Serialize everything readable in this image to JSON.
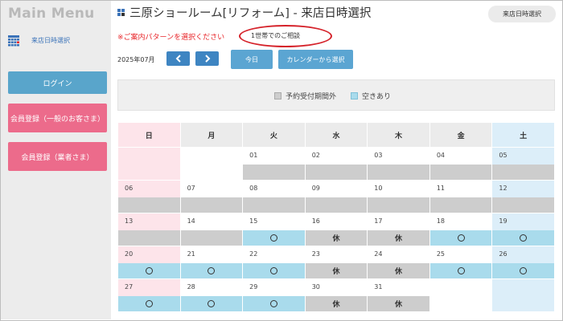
{
  "sidebar": {
    "title": "Main Menu",
    "link_label": "来店日時選択",
    "login_label": "ログイン",
    "register_general_label": "会員登録（一般のお客さま）",
    "register_business_label": "会員登録（業者さま）"
  },
  "header": {
    "title": "三原ショールーム[リフォーム] - 来店日時選択",
    "right_label": "来店日時選択"
  },
  "notice": "※ご案内パターンを選択ください",
  "pattern_label": "1世帯でのご相談",
  "month_label": "2025年07月",
  "buttons": {
    "today": "今日",
    "calendar_select": "カレンダーから選択"
  },
  "legend": {
    "closed": "予約受付期間外",
    "open": "空きあり"
  },
  "colors": {
    "closed": "#cdcdcd",
    "open": "#a9dbec",
    "sunday": "#fde4ea",
    "saturday": "#dceef9",
    "accent": "#3e85c2",
    "register": "#ec6b8b"
  },
  "calendar": {
    "weekdays": [
      "日",
      "月",
      "火",
      "水",
      "木",
      "金",
      "土"
    ],
    "weeks": [
      [
        {
          "date": "",
          "status": ""
        },
        {
          "date": "",
          "status": ""
        },
        {
          "date": "01",
          "status": "closed",
          "label": ""
        },
        {
          "date": "02",
          "status": "closed",
          "label": ""
        },
        {
          "date": "03",
          "status": "closed",
          "label": ""
        },
        {
          "date": "04",
          "status": "closed",
          "label": ""
        },
        {
          "date": "05",
          "status": "closed",
          "label": ""
        }
      ],
      [
        {
          "date": "06",
          "status": "closed",
          "label": ""
        },
        {
          "date": "07",
          "status": "closed",
          "label": ""
        },
        {
          "date": "08",
          "status": "closed",
          "label": ""
        },
        {
          "date": "09",
          "status": "closed",
          "label": ""
        },
        {
          "date": "10",
          "status": "closed",
          "label": ""
        },
        {
          "date": "11",
          "status": "closed",
          "label": ""
        },
        {
          "date": "12",
          "status": "closed",
          "label": ""
        }
      ],
      [
        {
          "date": "13",
          "status": "closed",
          "label": ""
        },
        {
          "date": "14",
          "status": "closed",
          "label": ""
        },
        {
          "date": "15",
          "status": "open",
          "label": ""
        },
        {
          "date": "16",
          "status": "closed",
          "label": "休"
        },
        {
          "date": "17",
          "status": "closed",
          "label": "休"
        },
        {
          "date": "18",
          "status": "open",
          "label": ""
        },
        {
          "date": "19",
          "status": "open",
          "label": ""
        }
      ],
      [
        {
          "date": "20",
          "status": "open",
          "label": ""
        },
        {
          "date": "21",
          "status": "open",
          "label": ""
        },
        {
          "date": "22",
          "status": "open",
          "label": ""
        },
        {
          "date": "23",
          "status": "closed",
          "label": "休"
        },
        {
          "date": "24",
          "status": "closed",
          "label": "休"
        },
        {
          "date": "25",
          "status": "open",
          "label": ""
        },
        {
          "date": "26",
          "status": "open",
          "label": ""
        }
      ],
      [
        {
          "date": "27",
          "status": "open",
          "label": ""
        },
        {
          "date": "28",
          "status": "open",
          "label": ""
        },
        {
          "date": "29",
          "status": "open",
          "label": ""
        },
        {
          "date": "30",
          "status": "closed",
          "label": "休"
        },
        {
          "date": "31",
          "status": "closed",
          "label": "休"
        },
        {
          "date": "",
          "status": ""
        },
        {
          "date": "",
          "status": ""
        }
      ]
    ]
  }
}
